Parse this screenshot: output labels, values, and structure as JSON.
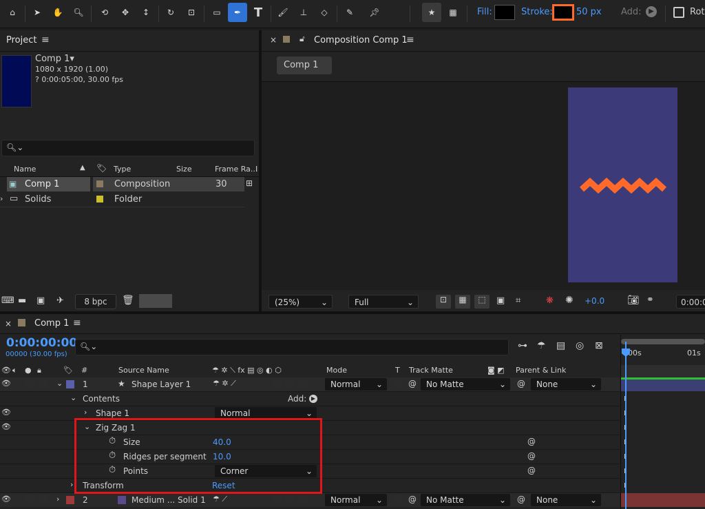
{
  "toolbar": {
    "fill_label": "Fill:",
    "stroke_label": "Stroke:",
    "stroke_width": "50 px",
    "add_label": "Add:",
    "rotate_label": "Rot",
    "colors": {
      "fill": "#000000",
      "stroke": "#ff6a2b",
      "accent": "#2f73d6"
    }
  },
  "project": {
    "title": "Project",
    "comp_name": "Comp 1▾",
    "comp_dims": "1080 x 1920 (1.00)",
    "comp_duration": "? 0:00:05:00, 30.00 fps",
    "search_placeholder": "",
    "columns": [
      "Name",
      "Type",
      "Size",
      "Frame Ra...",
      "I"
    ],
    "items": [
      {
        "name": "Comp 1",
        "type": "Composition",
        "frame_rate": "30",
        "label_color": "#8a7a60"
      },
      {
        "name": "Solids",
        "type": "Folder",
        "frame_rate": "",
        "label_color": "#c9c02a"
      }
    ],
    "bpc": "8 bpc"
  },
  "composition": {
    "title": "Composition Comp 1",
    "tab": "Comp 1",
    "zoom": "(25%)",
    "resolution": "Full",
    "exposure": "+0.0",
    "timecode": "0:00:0",
    "bg_color": "#3d3a7a",
    "zigzag_color": "#ff6a2b"
  },
  "timeline": {
    "tab": "Comp 1",
    "timecode": "0:00:00:00",
    "frames": "00000 (30.00 fps)",
    "col_num": "#",
    "col_source": "Source Name",
    "col_mode": "Mode",
    "col_t": "T",
    "col_track_matte": "Track Matte",
    "col_parent": "Parent & Link",
    "ruler": [
      "00s",
      "01s"
    ],
    "layers": [
      {
        "num": "1",
        "name": "Shape Layer 1",
        "mode": "Normal",
        "matte": "No Matte",
        "parent": "None"
      },
      {
        "num": "2",
        "name": "Medium ... Solid 1",
        "mode": "Normal",
        "matte": "No Matte",
        "parent": "None"
      }
    ],
    "contents_label": "Contents",
    "contents_add": "Add:",
    "shape1_label": "Shape 1",
    "shape1_mode": "Normal",
    "zigzag_label": "Zig Zag 1",
    "props": [
      {
        "name": "Size",
        "value": "40.0"
      },
      {
        "name": "Ridges per segment",
        "value": "10.0"
      },
      {
        "name": "Points",
        "value": "Corner"
      }
    ],
    "transform_label": "Transform",
    "transform_value": "Reset"
  }
}
